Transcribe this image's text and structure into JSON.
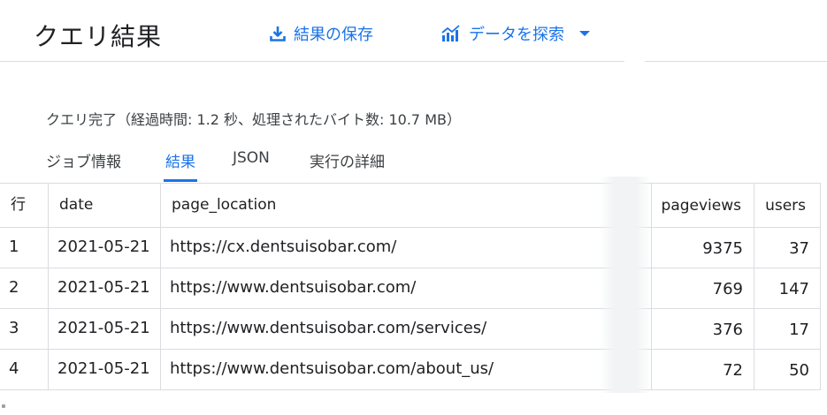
{
  "header": {
    "title": "クエリ結果",
    "save_label": "結果の保存",
    "explore_label": "データを探索"
  },
  "status": {
    "text": "クエリ完了（経過時間: 1.2 秒、処理されたバイト数: 10.7 MB）"
  },
  "tabs": [
    {
      "label": "ジョブ情報",
      "active": false
    },
    {
      "label": "結果",
      "active": true
    },
    {
      "label": "JSON",
      "active": false
    },
    {
      "label": "実行の詳細",
      "active": false
    }
  ],
  "table": {
    "columns": [
      "行",
      "date",
      "page_location",
      "pageviews",
      "users"
    ],
    "rows": [
      {
        "row": "1",
        "date": "2021-05-21",
        "page_location": "https://cx.dentsuisobar.com/",
        "pageviews": "9375",
        "users": "37"
      },
      {
        "row": "2",
        "date": "2021-05-21",
        "page_location": "https://www.dentsuisobar.com/",
        "pageviews": "769",
        "users": "147"
      },
      {
        "row": "3",
        "date": "2021-05-21",
        "page_location": "https://www.dentsuisobar.com/services/",
        "pageviews": "376",
        "users": "17"
      },
      {
        "row": "4",
        "date": "2021-05-21",
        "page_location": "https://www.dentsuisobar.com/about_us/",
        "pageviews": "72",
        "users": "50"
      }
    ]
  },
  "colors": {
    "accent": "#1a73e8",
    "divider": "#dadce0"
  },
  "icons": [
    "download-icon",
    "chart-icon",
    "caret-down-icon"
  ]
}
